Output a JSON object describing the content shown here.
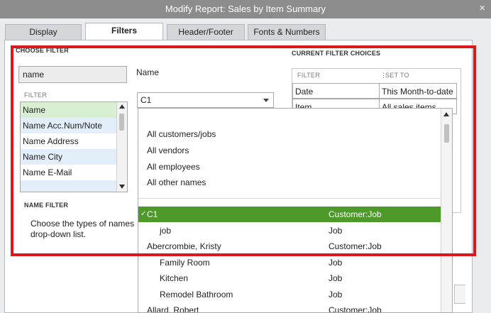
{
  "window": {
    "title": "Modify Report: Sales by Item Summary",
    "close_glyph": "×"
  },
  "tabs": [
    {
      "label": "Display",
      "active": false
    },
    {
      "label": "Filters",
      "active": true
    },
    {
      "label": "Header/Footer",
      "active": false
    },
    {
      "label": "Fonts & Numbers",
      "active": false
    }
  ],
  "choose_filter": {
    "section_title": "CHOOSE FILTER",
    "search_value": "name",
    "list_header": "FILTER",
    "items": [
      "Name",
      "Name Acc.Num/Note",
      "Name Address",
      "Name City",
      "Name E-Mail"
    ],
    "selected_index": 0
  },
  "name_field": {
    "label": "Name",
    "value": "C1"
  },
  "current_filters": {
    "section_title": "CURRENT FILTER CHOICES",
    "col_filter": "FILTER",
    "col_set_to": "SET TO",
    "rows": [
      {
        "filter": "Date",
        "set_to": "This Month-to-date"
      },
      {
        "filter": "Item",
        "set_to": "All sales items"
      }
    ]
  },
  "name_filter": {
    "section_title": "NAME FILTER",
    "description": "Choose the types of names drop-down list."
  },
  "dropdown": {
    "general": [
      "All customers/jobs",
      "All vendors",
      "All employees",
      "All other names"
    ],
    "entries": [
      {
        "name": "C1",
        "type": "Customer:Job",
        "selected": true,
        "indent": false,
        "check": "✓"
      },
      {
        "name": "job",
        "type": "Job",
        "selected": false,
        "indent": true
      },
      {
        "name": "Abercrombie, Kristy",
        "type": "Customer:Job",
        "selected": false,
        "indent": false
      },
      {
        "name": "Family Room",
        "type": "Job",
        "selected": false,
        "indent": true
      },
      {
        "name": "Kitchen",
        "type": "Job",
        "selected": false,
        "indent": true
      },
      {
        "name": "Remodel Bathroom",
        "type": "Job",
        "selected": false,
        "indent": true
      },
      {
        "name": "Allard, Robert",
        "type": "Customer:Job",
        "selected": false,
        "indent": false
      }
    ]
  },
  "colors": {
    "selection": "#4d9a2b",
    "list_highlight": "#d9efd1",
    "highlight_box": "#d9191c",
    "alt_row": "#e2eefa"
  }
}
